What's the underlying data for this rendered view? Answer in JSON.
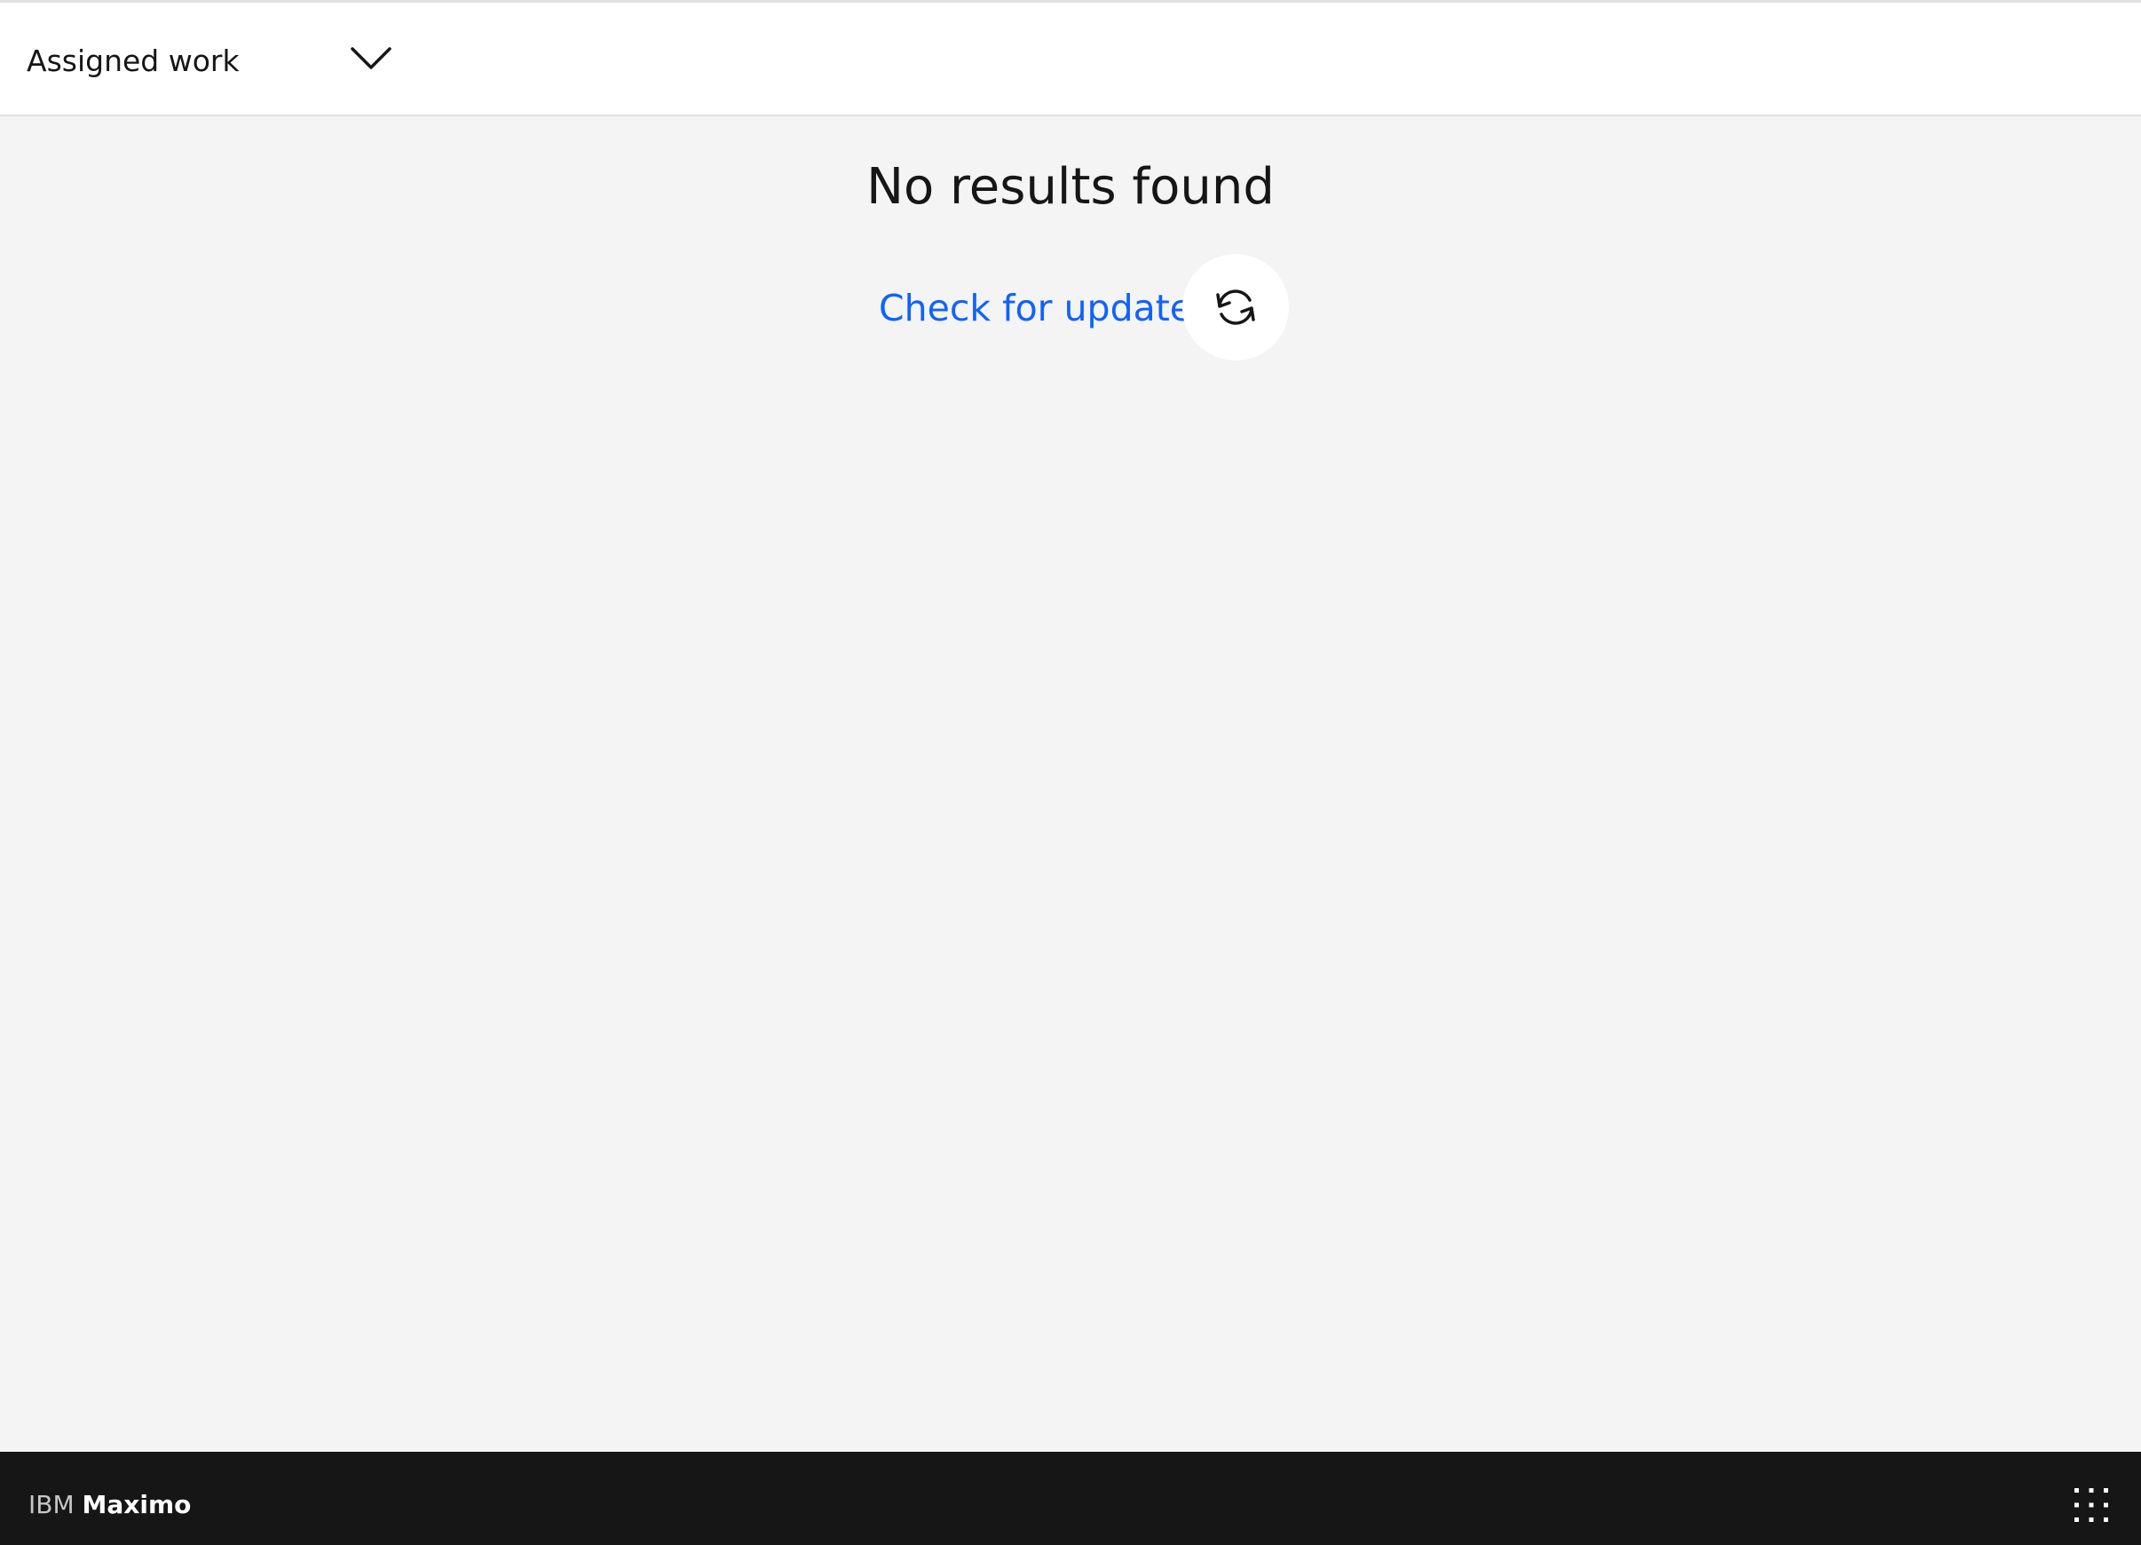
{
  "header": {
    "view_selector": {
      "label": "Assigned work",
      "icon": "chevron-down-icon"
    }
  },
  "main": {
    "empty_state": {
      "title": "No results found",
      "check_updates_label": "Check for updates",
      "refresh_icon": "refresh-icon"
    }
  },
  "footer": {
    "brand_company": "IBM",
    "brand_product": "Maximo",
    "app_switcher_icon": "app-switcher-icon"
  },
  "colors": {
    "link": "#0f62fe",
    "footer_bg": "#161616",
    "page_bg": "#f4f4f4",
    "text": "#161616"
  }
}
